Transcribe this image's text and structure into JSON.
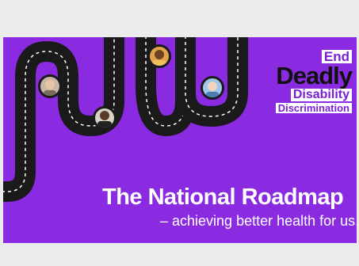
{
  "logo": {
    "line1": "End",
    "line2": "Deadly",
    "line3": "Disability",
    "line4": "Discrimination"
  },
  "headline": "The National Roadmap",
  "subline": "– achieving better health for us.",
  "colors": {
    "background": "#8a2be2",
    "road": "#1a1a1a",
    "road_marking": "#ffffff",
    "frame": "#ececec"
  },
  "icons": [
    "person-photo-1",
    "person-photo-2",
    "person-photo-3",
    "person-photo-4"
  ]
}
